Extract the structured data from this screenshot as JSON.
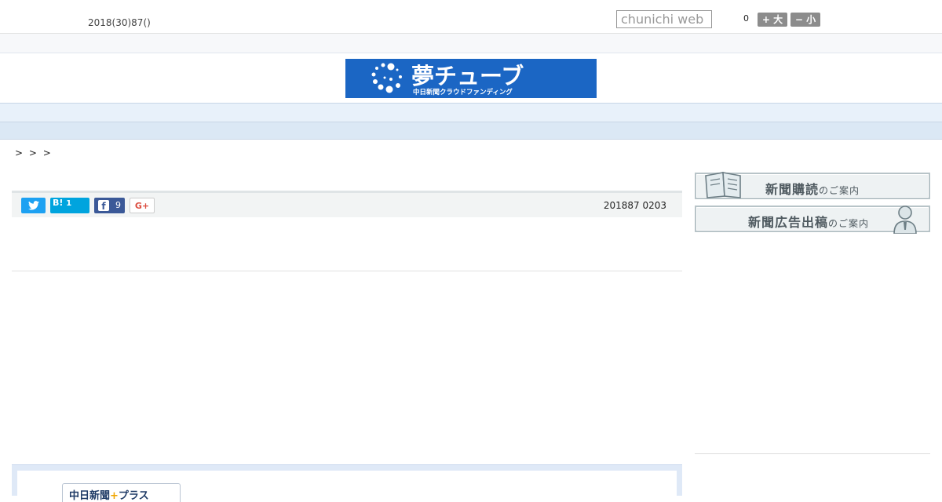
{
  "header": {
    "date": "2018(30)87()",
    "search_placeholder": "chunichi web",
    "count": "0",
    "font_larger": "+ 大",
    "font_smaller": "− 小"
  },
  "banner": {
    "title": "夢チューブ",
    "subtitle": "中日新聞クラウドファンディング",
    "brand_color": "#1b66c4"
  },
  "nav": {
    "items": [
      "",
      "",
      "",
      "",
      "",
      "",
      "",
      "",
      ""
    ]
  },
  "breadcrumb": "> > >",
  "share": {
    "hatena_label": "B!",
    "hatena_count": "1",
    "facebook_count": "9",
    "gplus_label": "G+",
    "published": "201887 0203"
  },
  "sidebar": {
    "subscribe": {
      "main": "新聞購読",
      "sub": "のご案内"
    },
    "advertise": {
      "main": "新聞広告出稿",
      "sub": "のご案内"
    }
  },
  "plus": {
    "logo_text": "中日新聞",
    "logo_suffix": "プラス",
    "logo_star": "+"
  }
}
